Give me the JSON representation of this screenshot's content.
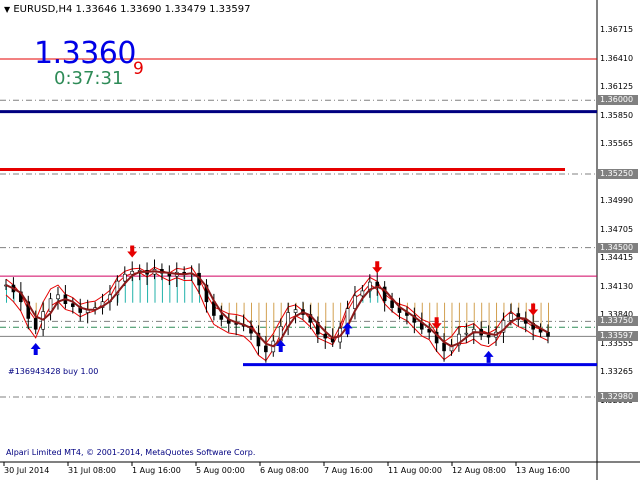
{
  "header": {
    "symbol_text": "EURUSD,H4  1.33646 1.33690 1.33479 1.33597",
    "price_main": "1.3360",
    "price_super": "9",
    "countdown": "0:37:31",
    "order_label": "#136943428 buy 1.00",
    "copyright": "Alpari Limited MT4, © 2001-2014, MetaQuotes Software Corp."
  },
  "price_axis": {
    "labels": [
      "1.36715",
      "1.36410",
      "1.36125",
      "1.35850",
      "1.35565",
      "1.35280",
      "1.34990",
      "1.34705",
      "1.34415",
      "1.34130",
      "1.33840",
      "1.33555",
      "1.33265",
      "1.32980"
    ],
    "tags": [
      {
        "text": "1.36000",
        "bg": "#808080",
        "fg": "#ffffff"
      },
      {
        "text": "1.35250",
        "bg": "#808080",
        "fg": "#ffffff"
      },
      {
        "text": "1.34500",
        "bg": "#808080",
        "fg": "#ffffff"
      },
      {
        "text": "1.33750",
        "bg": "#808080",
        "fg": "#ffffff"
      },
      {
        "text": "1.33597",
        "bg": "#808080",
        "fg": "#ffffff"
      },
      {
        "text": "1.32980",
        "bg": "#808080",
        "fg": "#ffffff"
      }
    ]
  },
  "time_axis": {
    "labels": [
      "30 Jul 2014",
      "31 Jul 08:00",
      "1 Aug 16:00",
      "5 Aug 00:00",
      "6 Aug 08:00",
      "7 Aug 16:00",
      "11 Aug 00:00",
      "12 Aug 08:00",
      "13 Aug 16:00"
    ]
  },
  "colors": {
    "background": "#ffffff",
    "candle": "#000000",
    "ma_line": "#8b1a1a",
    "envelope": "#e60000",
    "hist_cyan": "#20b2aa",
    "hist_orange": "#d2a050",
    "support_blue": "#0000e6",
    "navy_line": "#000080",
    "magenta_line": "#e6007e",
    "red_level": "#e60000"
  },
  "chart_data": {
    "type": "candlestick",
    "symbol": "EURUSD",
    "timeframe": "H4",
    "ohlc_last": {
      "open": 1.33646,
      "high": 1.3369,
      "low": 1.33479,
      "close": 1.33597
    },
    "levels": [
      {
        "price": 1.3642,
        "color": "#e60000",
        "style": "solid"
      },
      {
        "price": 1.36,
        "color": "#808080",
        "style": "dash"
      },
      {
        "price": 1.35885,
        "color": "#000080",
        "style": "solid-thick"
      },
      {
        "price": 1.35295,
        "color": "#e60000",
        "style": "solid-thick"
      },
      {
        "price": 1.3525,
        "color": "#808080",
        "style": "dash"
      },
      {
        "price": 1.345,
        "color": "#808080",
        "style": "dash"
      },
      {
        "price": 1.3421,
        "color": "#d00060",
        "style": "solid"
      },
      {
        "price": 1.3375,
        "color": "#808080",
        "style": "dash"
      },
      {
        "price": 1.3369,
        "color": "#2e8b57",
        "style": "dash"
      },
      {
        "price": 1.33597,
        "color": "#808080",
        "style": "solid"
      },
      {
        "price": 1.3331,
        "color": "#0000e6",
        "style": "solid-thick"
      },
      {
        "price": 1.3298,
        "color": "#808080",
        "style": "dash"
      }
    ],
    "close_series": [
      1.3412,
      1.3405,
      1.3395,
      1.3378,
      1.3367,
      1.3385,
      1.3398,
      1.3402,
      1.3393,
      1.339,
      1.3384,
      1.3387,
      1.3389,
      1.3395,
      1.3402,
      1.3416,
      1.3423,
      1.3426,
      1.3427,
      1.3423,
      1.3428,
      1.3424,
      1.3421,
      1.3425,
      1.3423,
      1.3424,
      1.3412,
      1.3395,
      1.3381,
      1.3377,
      1.3373,
      1.3372,
      1.337,
      1.3363,
      1.335,
      1.3344,
      1.3355,
      1.337,
      1.3384,
      1.3387,
      1.3382,
      1.3374,
      1.3362,
      1.3358,
      1.3354,
      1.3368,
      1.3388,
      1.3401,
      1.3406,
      1.3415,
      1.341,
      1.3396,
      1.3389,
      1.3384,
      1.3381,
      1.3374,
      1.3367,
      1.3364,
      1.3353,
      1.3345,
      1.3351,
      1.3362,
      1.3363,
      1.3367,
      1.3361,
      1.3359,
      1.3364,
      1.3376,
      1.3383,
      1.3377,
      1.3373,
      1.3367,
      1.3364,
      1.33597
    ],
    "buy_arrows_at_index": [
      4,
      37,
      46,
      65
    ],
    "sell_arrows_at_index": [
      17,
      50,
      58,
      71
    ]
  }
}
